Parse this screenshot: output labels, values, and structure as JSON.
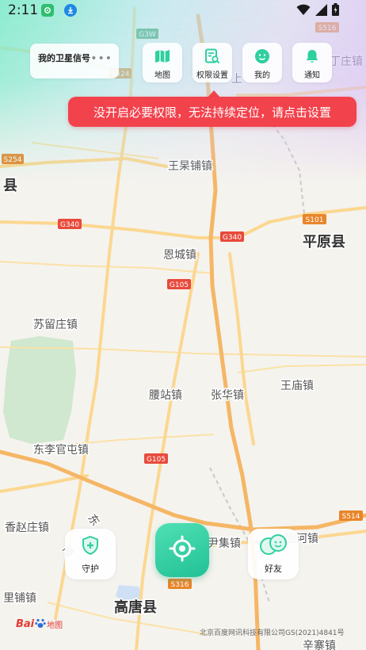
{
  "status_bar": {
    "time": "2:11"
  },
  "signal_card": {
    "label": "我的卫星信号",
    "more": "•••"
  },
  "toolbar": [
    {
      "label": "地图",
      "icon": "map-icon"
    },
    {
      "label": "权限设置",
      "icon": "permission-settings-icon"
    },
    {
      "label": "我的",
      "icon": "profile-face-icon"
    },
    {
      "label": "通知",
      "icon": "bell-icon"
    }
  ],
  "tooltip": {
    "text": "没开启必要权限，无法持续定位，请点击设置"
  },
  "bottom": {
    "guard_label": "守护",
    "friends_label": "好友",
    "locate_icon": "locate-crosshair-icon"
  },
  "footer": {
    "logo_text": "Bai",
    "logo_text2": "地图",
    "copyright": "北京百度网讯科技有限公司GS(2021)4841号"
  },
  "map": {
    "towns": [
      {
        "id": "wangguopu",
        "name": "王杲铺镇"
      },
      {
        "id": "encheng",
        "name": "恩城镇"
      },
      {
        "id": "suliuzhuang",
        "name": "苏留庄镇"
      },
      {
        "id": "yaozhan",
        "name": "腰站镇"
      },
      {
        "id": "zhanghua",
        "name": "张华镇"
      },
      {
        "id": "wangmiao",
        "name": "王庙镇"
      },
      {
        "id": "dongliguantun",
        "name": "东李官屯镇"
      },
      {
        "id": "xiangzhaozhuang",
        "name": "香赵庄镇"
      },
      {
        "id": "yinji",
        "name": "尹集镇"
      },
      {
        "id": "gudihe",
        "name": "固河镇"
      },
      {
        "id": "lipu",
        "name": "里铺镇"
      },
      {
        "id": "xinzhai",
        "name": "辛寨镇"
      },
      {
        "id": "dingzhuang",
        "name": "丁庄镇"
      },
      {
        "id": "dong",
        "name": "东"
      },
      {
        "id": "jiang",
        "name": "降"
      },
      {
        "id": "shang",
        "name": "上"
      }
    ],
    "counties": [
      {
        "id": "pingyuan",
        "name": "平原县"
      },
      {
        "id": "gaotang",
        "name": "高唐县"
      },
      {
        "id": "xian-left",
        "name": "县"
      }
    ],
    "shields": [
      {
        "id": "g3w",
        "label": "G3W",
        "type": "expressway"
      },
      {
        "id": "s516",
        "label": "S516",
        "type": "provincial"
      },
      {
        "id": "s524",
        "label": "S524",
        "type": "provincial"
      },
      {
        "id": "s254",
        "label": "S254",
        "type": "provincial"
      },
      {
        "id": "g340a",
        "label": "G340",
        "type": "national"
      },
      {
        "id": "g340b",
        "label": "G340",
        "type": "national"
      },
      {
        "id": "s101",
        "label": "S101",
        "type": "provincial"
      },
      {
        "id": "g105a",
        "label": "G105",
        "type": "national"
      },
      {
        "id": "g105b",
        "label": "G105",
        "type": "national"
      },
      {
        "id": "s514",
        "label": "S514",
        "type": "provincial"
      },
      {
        "id": "s316",
        "label": "S316",
        "type": "provincial"
      }
    ]
  },
  "colors": {
    "accent": "#2fcfa0",
    "tooltip_bg": "#f2424c",
    "national_shield": "#e84a3c",
    "provincial_shield": "#e9852a",
    "expressway_shield": "#3f9a58",
    "highway": "#f5b665",
    "road": "#fbd790"
  }
}
